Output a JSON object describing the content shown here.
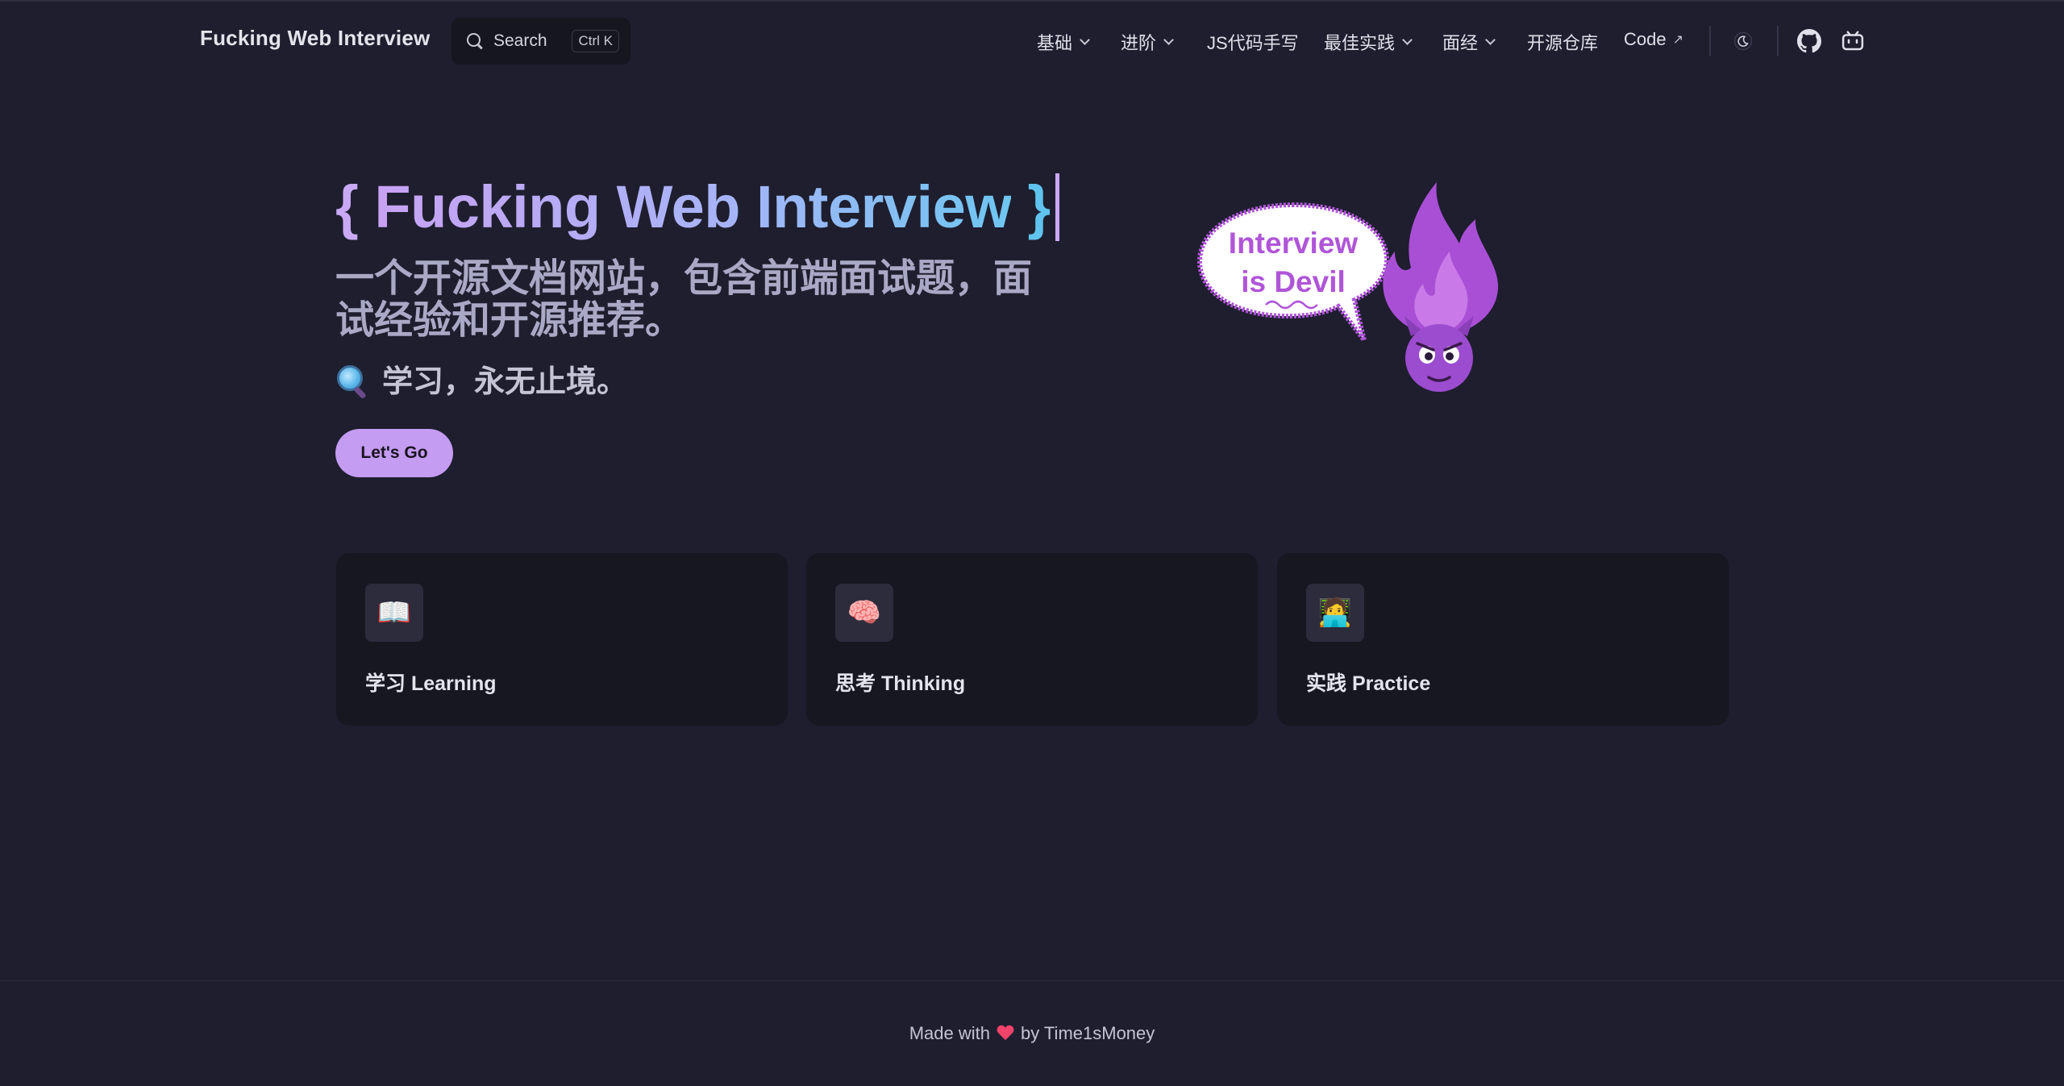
{
  "nav": {
    "brand": "Fucking Web Interview",
    "search": {
      "label": "Search",
      "kbd_ctrl": "Ctrl",
      "kbd_key": "K"
    },
    "menu": [
      {
        "label": "基础",
        "dropdown": true
      },
      {
        "label": "进阶",
        "dropdown": true
      },
      {
        "label": "JS代码手写",
        "dropdown": false
      },
      {
        "label": "最佳实践",
        "dropdown": true
      },
      {
        "label": "面经",
        "dropdown": true
      },
      {
        "label": "开源仓库",
        "dropdown": false
      },
      {
        "label": "Code",
        "external": true,
        "ext_glyph": "↗"
      }
    ],
    "icons": [
      "moon-icon",
      "github-icon",
      "bilibili-icon"
    ]
  },
  "hero": {
    "brace_left": "{",
    "title": "Fucking Web Interview",
    "brace_right": "}",
    "subtitle": "一个开源文档网站，包含前端面试题，面试经验和开源推荐。",
    "tagline": "学习，永无止境。",
    "cta": "Let's Go",
    "bubble_line1": "Interview",
    "bubble_line2": "is Devil"
  },
  "features": [
    {
      "icon": "📖",
      "icon_name": "open-book-icon",
      "title": "学习 Learning"
    },
    {
      "icon": "🧠",
      "icon_name": "brain-icon",
      "title": "思考 Thinking"
    },
    {
      "icon": "🧑‍💻",
      "icon_name": "technologist-icon",
      "title": "实践 Practice"
    }
  ],
  "footer": {
    "made_with": "Made with",
    "by": "by Time1sMoney"
  },
  "colors": {
    "background": "#1e1e2e",
    "accent": "#c49cf2",
    "gradient_end": "#5fc3ee",
    "card_bg": "#171722"
  }
}
